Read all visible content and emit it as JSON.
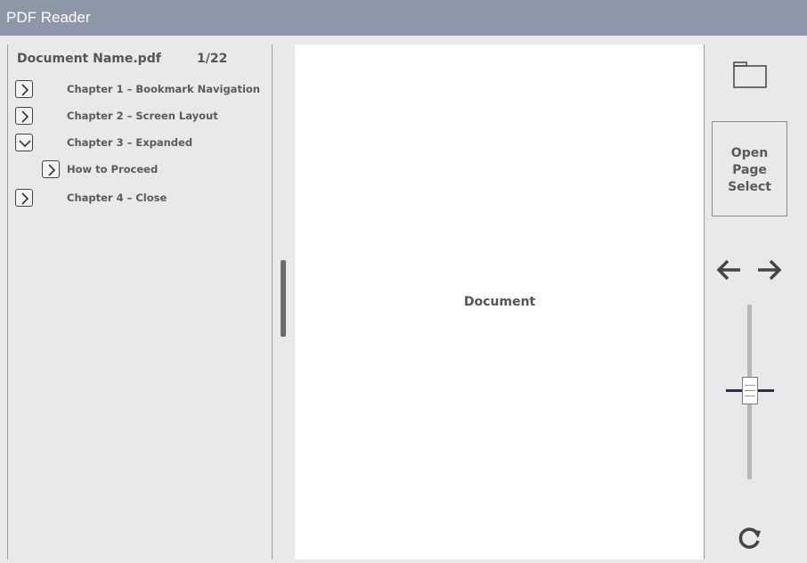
{
  "app": {
    "title": "PDF Reader"
  },
  "sidebar": {
    "document_name": "Document Name.pdf",
    "page_indicator": "1/22",
    "bookmarks": [
      {
        "label": "Chapter 1 – Bookmark Navigation",
        "state": "collapsed",
        "icon": "chevron-right-icon"
      },
      {
        "label": "Chapter 2 – Screen Layout",
        "state": "collapsed",
        "icon": "chevron-right-icon"
      },
      {
        "label": "Chapter 3 – Expanded",
        "state": "expanded",
        "icon": "chevron-down-icon"
      },
      {
        "label": "How to Proceed",
        "state": "collapsed",
        "icon": "chevron-right-icon",
        "level": 2
      },
      {
        "label": "Chapter 4 – Close",
        "state": "collapsed",
        "icon": "chevron-right-icon"
      }
    ]
  },
  "document": {
    "placeholder": "Document"
  },
  "toolbar": {
    "folder_icon": "folder-icon",
    "open_page_select_label": "Open\nPage\nSelect",
    "prev_icon": "arrow-left-icon",
    "next_icon": "arrow-right-icon",
    "zoom_level": 0.5,
    "refresh_icon": "refresh-icon"
  },
  "colors": {
    "titlebar": "#8e97a7",
    "background": "#e9e9ec",
    "document": "#ffffff",
    "text": "#555555"
  }
}
